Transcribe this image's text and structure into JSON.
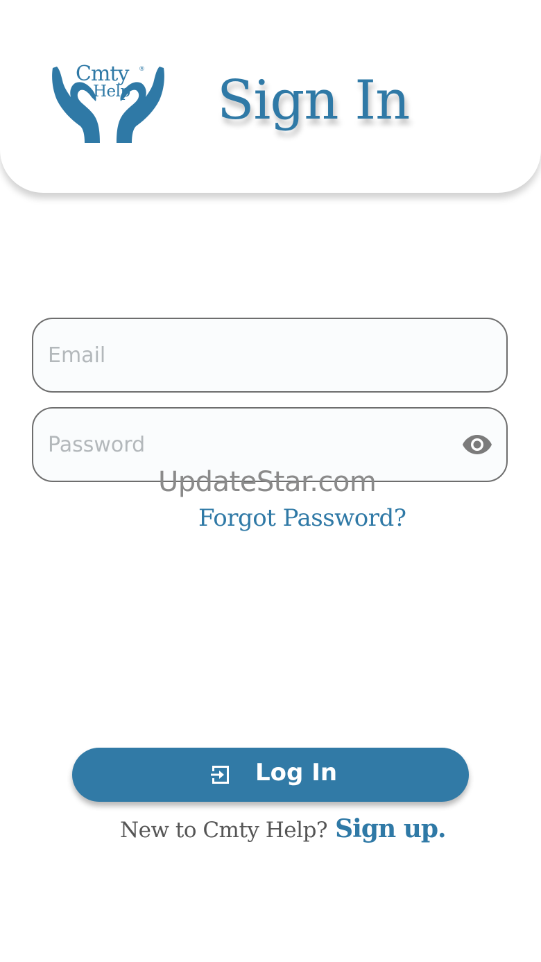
{
  "header": {
    "logo": {
      "line1": "Cmty",
      "line2": "Help",
      "registered": "®"
    },
    "title": "Sign In"
  },
  "form": {
    "email": {
      "placeholder": "Email",
      "value": ""
    },
    "password": {
      "placeholder": "Password",
      "value": "",
      "toggle_icon": "eye-icon"
    },
    "forgot_password": "Forgot Password?"
  },
  "watermark": "UpdateStar.com",
  "login_button": {
    "icon": "login-icon",
    "label": "Log In"
  },
  "signup": {
    "prompt": "New to Cmty Help?",
    "link": "Sign up."
  },
  "colors": {
    "brand": "#2f79a6",
    "button": "#317aa6",
    "field_border": "#6e6e6e",
    "placeholder": "#b3b8bb"
  }
}
